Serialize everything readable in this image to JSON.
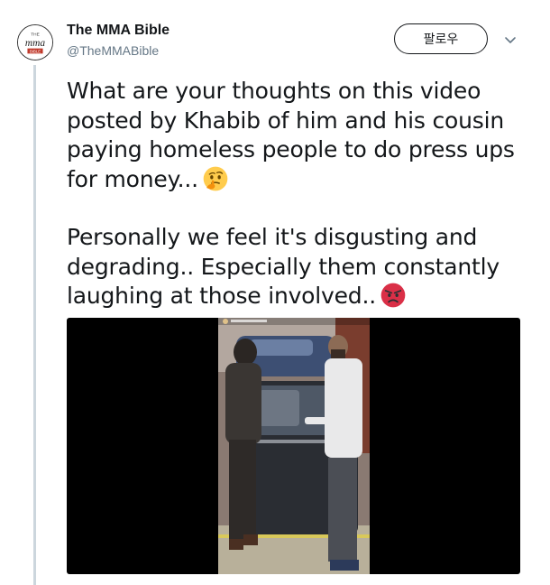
{
  "account": {
    "display_name": "The MMA Bible",
    "handle": "@TheMMABible",
    "avatar_text": "mma"
  },
  "actions": {
    "follow_label": "팔로우",
    "more_icon": "chevron-down-icon"
  },
  "tweet": {
    "paragraph_1": "What are your thoughts on this video posted by Khabib of him and his cousin paying homeless people to do press ups for money...",
    "paragraph_1_emoji": "thinking-face-emoji",
    "paragraph_2": "Personally we feel it's disgusting and degrading.. Especially them constantly laughing at those involved..",
    "paragraph_2_emoji": "angry-face-emoji"
  },
  "colors": {
    "text": "#14171a",
    "secondary_text": "#657786",
    "thread_line": "#ccd6dd",
    "media_background": "#000000"
  }
}
